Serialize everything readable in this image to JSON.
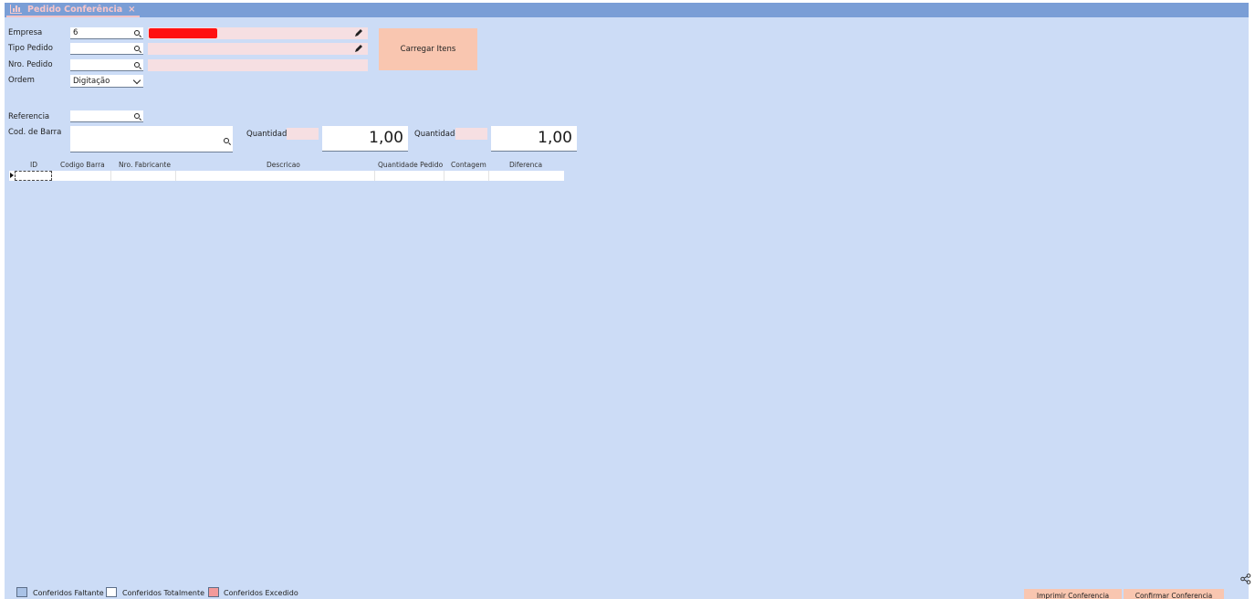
{
  "tab": {
    "title": "Pedido Conferência",
    "close": "×"
  },
  "form": {
    "empresa": {
      "label": "Empresa",
      "value": "6"
    },
    "tipo_pedido": {
      "label": "Tipo Pedido",
      "value": ""
    },
    "nro_pedido": {
      "label": "Nro. Pedido",
      "value": ""
    },
    "ordem": {
      "label": "Ordem",
      "selected": "Digitação"
    },
    "referencia": {
      "label": "Referencia",
      "value": ""
    },
    "cod_barra": {
      "label": "Cod. de Barra",
      "value": ""
    },
    "quantidade_1": {
      "label": "Quantidade",
      "value": "1,00"
    },
    "quantidade_2": {
      "label": "Quantidade",
      "value": "1,00"
    }
  },
  "buttons": {
    "carregar_itens": "Carregar Itens",
    "imprimir": "Imprimir Conferencia",
    "confirmar": "Confirmar Conferencia"
  },
  "grid": {
    "columns": [
      "ID",
      "Codigo Barra",
      "Nro. Fabricante",
      "Descricao",
      "Quantidade Pedido",
      "Contagem",
      "Diferenca"
    ]
  },
  "legend": [
    {
      "label": "Conferidos Faltante",
      "color": "#a9c2e6"
    },
    {
      "label": "Conferidos Totalmente",
      "color": "#ffffff"
    },
    {
      "label": "Conferidos Excedido",
      "color": "#f39a9a"
    }
  ],
  "colors": {
    "background": "#ccdcf6",
    "tabbar": "#7a9ed6",
    "accent_button": "#f9c6b0",
    "status_red": "#ff1111"
  }
}
